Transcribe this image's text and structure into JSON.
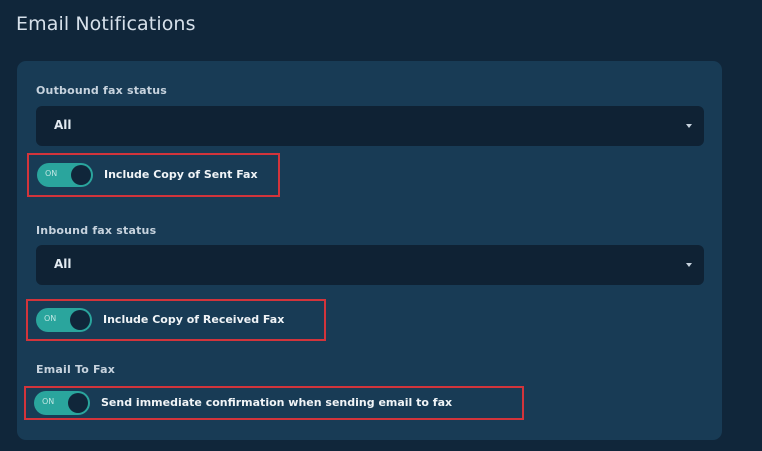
{
  "page": {
    "title": "Email Notifications"
  },
  "outbound": {
    "label": "Outbound fax status",
    "selected": "All",
    "toggle": {
      "state_label": "ON",
      "label": "Include Copy of Sent Fax"
    }
  },
  "inbound": {
    "label": "Inbound fax status",
    "selected": "All",
    "toggle": {
      "state_label": "ON",
      "label": "Include Copy of Received Fax"
    }
  },
  "email_to_fax": {
    "label": "Email To Fax",
    "toggle": {
      "state_label": "ON",
      "label": "Send immediate confirmation when sending email to fax"
    }
  },
  "icons": {
    "select_caret": "chevron-down-icon",
    "toggle_knob": "toggle-knob-icon"
  },
  "colors": {
    "background": "#10263a",
    "panel": "#183b55",
    "select": "#0f2234",
    "toggle_on": "#2aa59d",
    "highlight": "#d2343b",
    "heading_text": "#d6e0ea"
  }
}
